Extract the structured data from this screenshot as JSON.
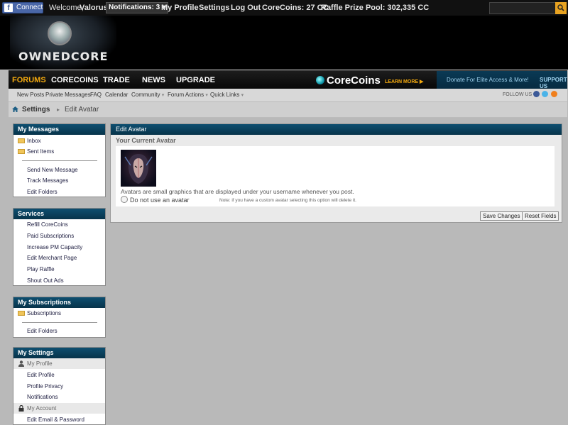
{
  "topbar": {
    "fb_connect": "Connect",
    "welcome": "Welcome,",
    "username": "Valorus",
    "notifications": "Notifications: 3",
    "my_profile": "My Profile",
    "settings": "Settings",
    "log_out": "Log Out",
    "corecoins": "CoreCoins: 27 CC",
    "raffle": "Raffle Prize Pool: 302,335 CC",
    "search_placeholder": ""
  },
  "header": {
    "logo_text": "OWNEDCORE"
  },
  "nav": {
    "tabs": [
      {
        "label": "FORUMS",
        "active": true
      },
      {
        "label": "CORECOINS",
        "active": false
      },
      {
        "label": "TRADE",
        "active": false
      },
      {
        "label": "NEWS",
        "active": false
      },
      {
        "label": "UPGRADE",
        "active": false
      }
    ],
    "corecoins_logo": "CoreCoins",
    "learn_more": "LEARN MORE ▶",
    "donate_text": "Donate For Elite Access & More!",
    "support_us": "SUPPORT US"
  },
  "subnav": {
    "items": [
      "New Posts",
      "Private Messages",
      "FAQ",
      "Calendar",
      "Community",
      "Forum Actions",
      "Quick Links"
    ],
    "follow_us": "FOLLOW US"
  },
  "breadcrumb": {
    "root": "Settings",
    "current": "Edit Avatar"
  },
  "sidebar": {
    "my_messages": {
      "title": "My Messages",
      "inbox": "Inbox",
      "sent_items": "Sent Items",
      "send_new": "Send New Message",
      "track": "Track Messages",
      "edit_folders": "Edit Folders"
    },
    "services": {
      "title": "Services",
      "items": [
        "Refill CoreCoins",
        "Paid Subscriptions",
        "Increase PM Capacity",
        "Edit Merchant Page",
        "Play Raffle",
        "Shout Out Ads"
      ]
    },
    "my_subscriptions": {
      "title": "My Subscriptions",
      "subscriptions": "Subscriptions",
      "edit_folders": "Edit Folders"
    },
    "my_settings": {
      "title": "My Settings",
      "group_profile": "My Profile",
      "edit_profile": "Edit Profile",
      "profile_privacy": "Profile Privacy",
      "notifications": "Notifications",
      "group_account": "My Account",
      "edit_email": "Edit Email & Password"
    }
  },
  "main": {
    "title": "Edit Avatar",
    "current_avatar_heading": "Your Current Avatar",
    "avatar_desc": "Avatars are small graphics that are displayed under your username whenever you post.",
    "no_avatar_label": "Do not use an avatar",
    "no_avatar_note": "Note: if you have a custom avatar selecting this option will delete it.",
    "save_button": "Save Changes",
    "reset_button": "Reset Fields"
  },
  "colors": {
    "accent": "#f3a90e",
    "block_header": "#0e4f70",
    "facebook": "#4a67a8"
  }
}
